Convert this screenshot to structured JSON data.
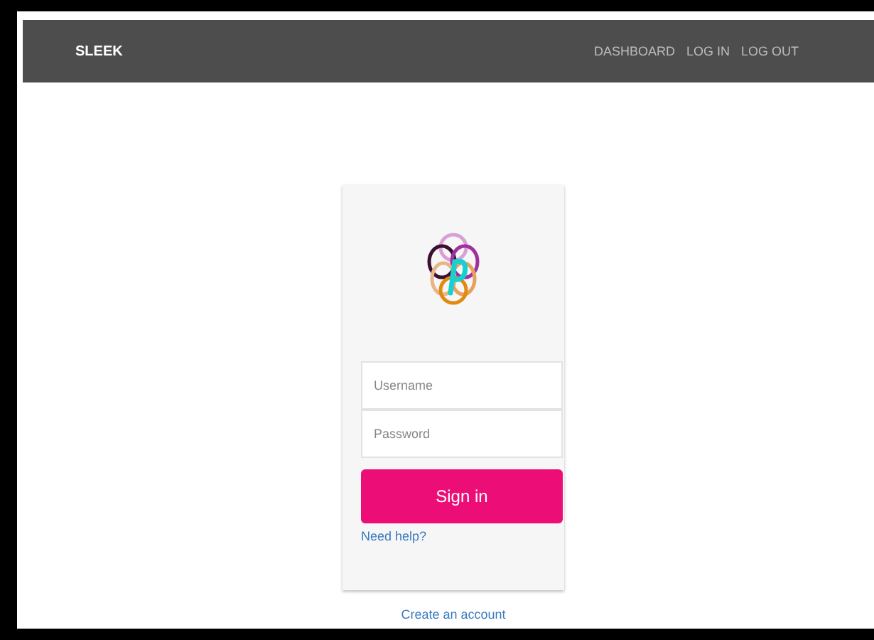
{
  "navbar": {
    "brand": "SLEEK",
    "links": [
      "DASHBOARD",
      "LOG IN",
      "LOG OUT"
    ]
  },
  "login": {
    "username": {
      "placeholder": "Username"
    },
    "password": {
      "placeholder": "Password"
    },
    "submit": "Sign in",
    "help_link": "Need help?"
  },
  "footer_link": "Create an account"
}
